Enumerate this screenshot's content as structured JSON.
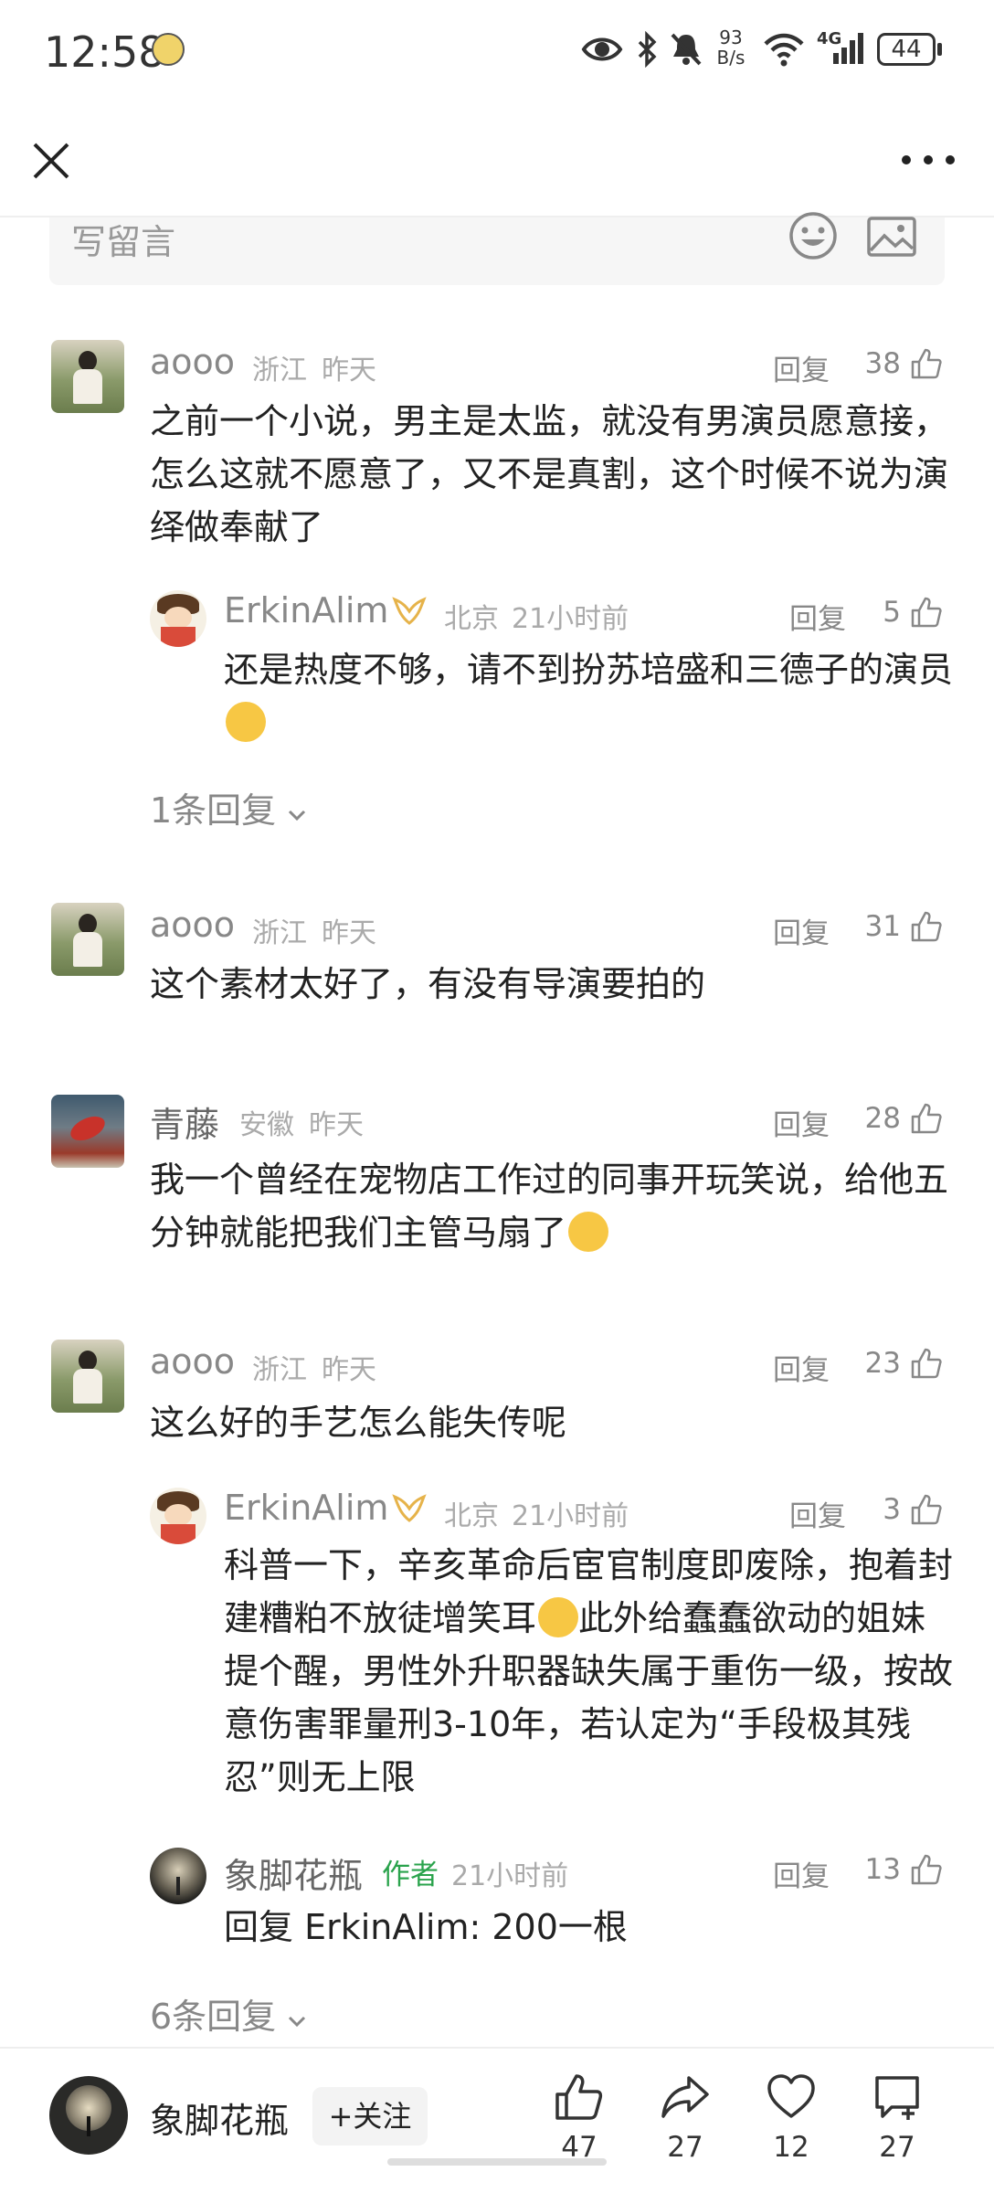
{
  "status_bar": {
    "time": "12:58",
    "net_speed_value": "93",
    "net_speed_unit": "B/s",
    "signal_label": "4G",
    "battery": "44"
  },
  "write_comment": {
    "placeholder": "写留言"
  },
  "comments": [
    {
      "user": "aooo",
      "location": "浙江",
      "time": "昨天",
      "reply_label": "回复",
      "likes": "38",
      "text": "之前一个小说，男主是太监，就没有男演员愿意接，怎么这就不愿意了，又不是真割，这个时候不说为演绎做奉献了",
      "replies": [
        {
          "user": "ErkinAlim",
          "location": "北京",
          "time": "21小时前",
          "reply_label": "回复",
          "likes": "5",
          "text": "还是热度不够，请不到扮苏培盛和三德子的演员"
        }
      ],
      "more_replies": "1条回复"
    },
    {
      "user": "aooo",
      "location": "浙江",
      "time": "昨天",
      "reply_label": "回复",
      "likes": "31",
      "text": "这个素材太好了，有没有导演要拍的"
    },
    {
      "user": "青藤",
      "location": "安徽",
      "time": "昨天",
      "reply_label": "回复",
      "likes": "28",
      "text": "我一个曾经在宠物店工作过的同事开玩笑说，给他五分钟就能把我们主管马扇了"
    },
    {
      "user": "aooo",
      "location": "浙江",
      "time": "昨天",
      "reply_label": "回复",
      "likes": "23",
      "text": "这么好的手艺怎么能失传呢",
      "replies": [
        {
          "user": "ErkinAlim",
          "location": "北京",
          "time": "21小时前",
          "reply_label": "回复",
          "likes": "3",
          "text_part1": "科普一下，辛亥革命后宦官制度即废除，抱着封建糟粕不放徒增笑耳",
          "text_part2": "此外给蠢蠢欲动的姐妹提个醒，男性外升职器缺失属于重伤一级，按故意伤害罪量刑3-10年，若认定为“手段极其残忍”则无上限"
        },
        {
          "user": "象脚花瓶",
          "author_tag": "作者",
          "time": "21小时前",
          "reply_label": "回复",
          "likes": "13",
          "text": "回复 ErkinAlim: 200一根"
        }
      ],
      "more_replies": "6条回复"
    }
  ],
  "bottom_bar": {
    "author_name": "象脚花瓶",
    "follow_label": "+关注",
    "like_count": "47",
    "share_count": "27",
    "favorite_count": "12",
    "comment_count": "27"
  },
  "colors": {
    "author_tag": "#2aa34c",
    "meta_gray": "#aaaaaa",
    "text": "#222222"
  },
  "icons": [
    "close-icon",
    "more-icon",
    "emoji-icon",
    "image-icon",
    "thumb-up-icon",
    "share-icon",
    "heart-icon",
    "comment-icon",
    "chevron-down-icon",
    "eye-icon",
    "bluetooth-icon",
    "mute-icon",
    "wifi-icon",
    "signal-icon",
    "battery-icon"
  ]
}
